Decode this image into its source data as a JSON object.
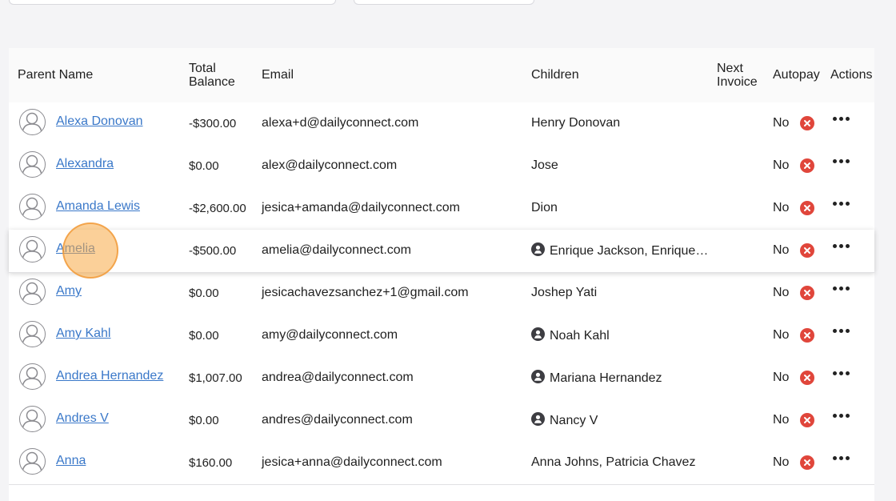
{
  "table": {
    "headers": {
      "parent_name": "Parent Name",
      "total_balance_line1": "Total",
      "total_balance_line2": "Balance",
      "email": "Email",
      "children": "Children",
      "next_invoice_line1": "Next",
      "next_invoice_line2": "Invoice",
      "autopay": "Autopay",
      "actions": "Actions"
    },
    "rows": [
      {
        "name": "Alexa Donovan",
        "balance": "-$300.00",
        "email": "alexa+d@dailyconnect.com",
        "children": "Henry Donovan",
        "child_icon": false,
        "autopay": "No"
      },
      {
        "name": "Alexandra",
        "balance": "$0.00",
        "email": "alex@dailyconnect.com",
        "children": "Jose",
        "child_icon": false,
        "autopay": "No"
      },
      {
        "name": "Amanda Lewis",
        "balance": "-$2,600.00",
        "email": "jesica+amanda@dailyconnect.com",
        "children": "Dion",
        "child_icon": false,
        "autopay": "No"
      },
      {
        "name": "Amelia",
        "balance": "-$500.00",
        "email": "amelia@dailyconnect.com",
        "children": "Enrique Jackson, Enrique…",
        "child_icon": true,
        "autopay": "No"
      },
      {
        "name": "Amy",
        "balance": "$0.00",
        "email": "jesicachavezsanchez+1@gmail.com",
        "children": "Joshep Yati",
        "child_icon": false,
        "autopay": "No"
      },
      {
        "name": "Amy Kahl",
        "balance": "$0.00",
        "email": "amy@dailyconnect.com",
        "children": "Noah Kahl",
        "child_icon": true,
        "autopay": "No"
      },
      {
        "name": "Andrea Hernandez",
        "balance": "$1,007.00",
        "email": "andrea@dailyconnect.com",
        "children": "Mariana Hernandez",
        "child_icon": true,
        "autopay": "No"
      },
      {
        "name": "Andres V",
        "balance": "$0.00",
        "email": "andres@dailyconnect.com",
        "children": "Nancy V",
        "child_icon": true,
        "autopay": "No"
      },
      {
        "name": "Anna",
        "balance": "$160.00",
        "email": "jesica+anna@dailyconnect.com",
        "children": "Anna Johns, Patricia Chavez",
        "child_icon": false,
        "autopay": "No"
      }
    ]
  },
  "icons": {
    "avatar": "user-avatar-icon",
    "child": "child-badge-icon",
    "autopay_off": "x-circle-icon",
    "actions": "more-dots-icon"
  },
  "colors": {
    "link": "#3a78c9",
    "autopay_off": "#e0463b",
    "cursor_highlight": "#f8aa46"
  }
}
